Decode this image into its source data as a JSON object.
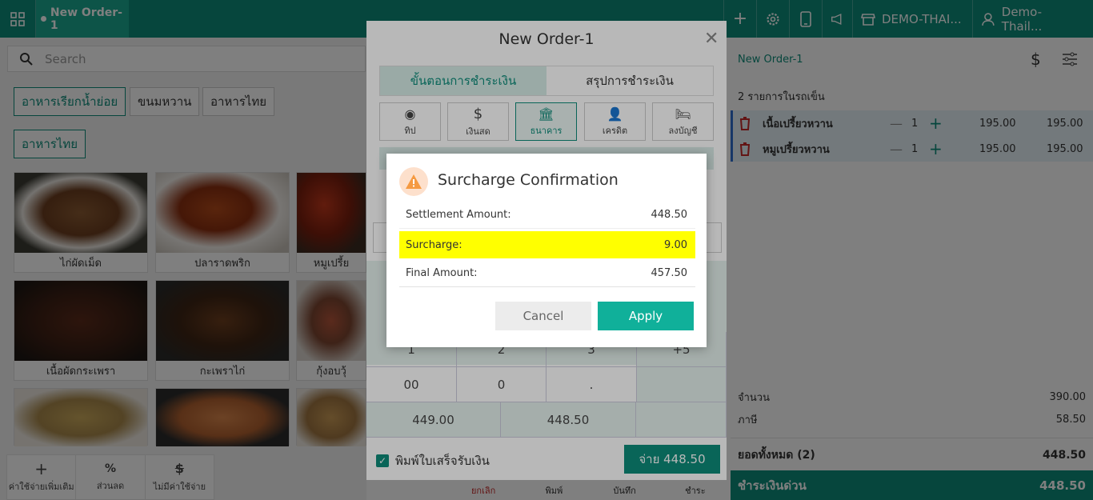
{
  "topbar": {
    "order_tab": "New Order-1",
    "store": "DEMO-THAI...",
    "user": "Demo- Thail..."
  },
  "search": {
    "placeholder": "Search"
  },
  "categories": [
    "อาหารเรียกน้ำย่อย",
    "ขนมหวาน",
    "อาหารไทย"
  ],
  "subcategory": "อาหารไทย",
  "menu_items": [
    "ไก่ผัดเม็ด",
    "ปลาราดพริก",
    "หมูเปรี้ย",
    "เนื้อผัดกระเพรา",
    "กะเพราไก่",
    "กุ้งอบวุ้",
    "",
    "",
    ""
  ],
  "tools": {
    "extra": "ค่าใช้จ่ายเพิ่มเติม",
    "discount": "ส่วนลด",
    "no_charge": "ไม่มีค่าใช้จ่าย"
  },
  "cart": {
    "title": "New Order-1",
    "count_label": "2 รายการในรถเข็น",
    "items": [
      {
        "name": "เนื้อเปรี้ยวหวาน",
        "qty": "1",
        "price": "195.00",
        "total": "195.00"
      },
      {
        "name": "หมูเปรี้ยวหวาน",
        "qty": "1",
        "price": "195.00",
        "total": "195.00"
      }
    ],
    "subtotal_label": "จำนวน",
    "subtotal": "390.00",
    "tax_label": "ภาษี",
    "tax": "58.50",
    "grand_label": "ยอดทั้งหมด",
    "grand_count": "(2)",
    "grand": "448.50",
    "quick_pay_label": "ชำระเงินด่วน",
    "quick_pay": "448.50",
    "bottom_actions": [
      "ยกเลิก",
      "พิมพ์",
      "บันทึก",
      "ชำระ"
    ]
  },
  "modal": {
    "title": "New Order-1",
    "tabs": [
      "ขั้นตอนการชำระเงิน",
      "สรุปการชำระเงิน"
    ],
    "methods": [
      {
        "label": "ทิป",
        "icon": "coins-icon"
      },
      {
        "label": "เงินสด",
        "icon": "dollar-icon"
      },
      {
        "label": "ธนาคาร",
        "icon": "bank-icon"
      },
      {
        "label": "เครดิต",
        "icon": "user-icon"
      },
      {
        "label": "ลงบัญชี",
        "icon": "bed-icon"
      }
    ],
    "keypad": [
      [
        "1",
        "2",
        "3",
        "+5"
      ],
      [
        "00",
        "0",
        ".",
        ""
      ]
    ],
    "amounts": [
      "449.00",
      "448.50",
      ""
    ],
    "print_label": "พิมพ์ใบเสร็จรับเงิน",
    "pay_button": "จ่าย 448.50"
  },
  "dialog": {
    "title": "Surcharge Confirmation",
    "settlement_label": "Settlement Amount:",
    "settlement": "448.50",
    "surcharge_label": "Surcharge:",
    "surcharge": "9.00",
    "final_label": "Final Amount:",
    "final": "457.50",
    "cancel": "Cancel",
    "apply": "Apply"
  },
  "colors": {
    "brand": "#0d8c7a",
    "accent": "#10b09a",
    "highlight": "#ffff00",
    "warning": "#f59a42"
  }
}
